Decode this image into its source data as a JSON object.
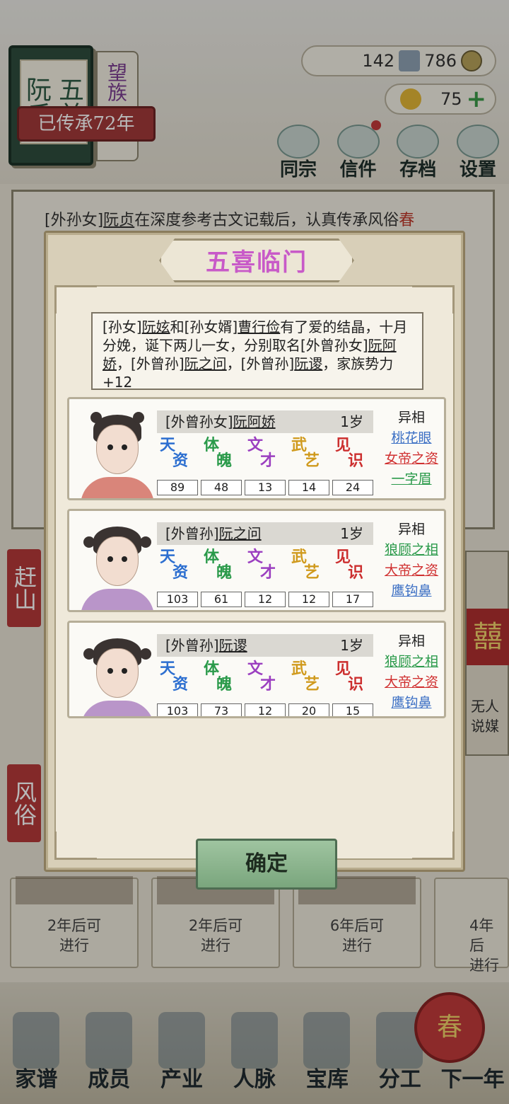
{
  "family": {
    "cover_title": "五羊阮氏",
    "side_title": "望族",
    "heritage": "已传承72年"
  },
  "resources": {
    "silver": "142",
    "coins": "786",
    "gold": "75"
  },
  "top_menu": [
    {
      "label": "同宗",
      "icon": "family-icon"
    },
    {
      "label": "信件",
      "icon": "letter-icon"
    },
    {
      "label": "存档",
      "icon": "save-icon"
    },
    {
      "label": "设置",
      "icon": "settings-icon"
    }
  ],
  "notice": {
    "prefix": "[外孙女]",
    "name": "阮贞",
    "body": "在深度参考古文记载后，认真传承风俗",
    "highlight": "春"
  },
  "side_tags": {
    "left_top": "赶山",
    "left_bottom": "风俗"
  },
  "right_card": {
    "text": "无人说媒"
  },
  "tasks": [
    {
      "text1": "2年后可",
      "text2": "进行"
    },
    {
      "text1": "2年后可",
      "text2": "进行"
    },
    {
      "text1": "6年后可",
      "text2": "进行"
    },
    {
      "text1": "4年后",
      "text2": "进行"
    }
  ],
  "nav": [
    {
      "label": "家谱"
    },
    {
      "label": "成员"
    },
    {
      "label": "产业"
    },
    {
      "label": "人脉"
    },
    {
      "label": "宝库"
    },
    {
      "label": "分工"
    },
    {
      "label": "下一年"
    }
  ],
  "lantern": "春",
  "dialog": {
    "title": "五喜临门",
    "message_parts": {
      "p1": "[孙女]",
      "n1": "阮妶",
      "p2": "和[孙女婿]",
      "n2": "曹行俭",
      "p3": "有了爱的结晶，十月分娩，诞下两儿一女，分别取名[外曾孙女]",
      "n3": "阮阿娇",
      "p4": "，[外曾孙]",
      "n4": "阮之问",
      "p5": "，[外曾孙]",
      "n5": "阮谡",
      "p6": "，家族势力+12"
    },
    "stat_labels": [
      {
        "a": "天",
        "b": "资",
        "color": "#2d6fd0"
      },
      {
        "a": "体",
        "b": "魄",
        "color": "#2a9a4a"
      },
      {
        "a": "文",
        "b": "才",
        "color": "#9b3fc0"
      },
      {
        "a": "武",
        "b": "艺",
        "color": "#d09a1d"
      },
      {
        "a": "见",
        "b": "识",
        "color": "#cc2f2f"
      }
    ],
    "children": [
      {
        "prefix": "[外曾孙女]",
        "name": "阮阿娇",
        "age": "1岁",
        "stats": [
          "89",
          "48",
          "13",
          "14",
          "24"
        ],
        "traits_header": "异相",
        "traits": [
          {
            "text": "桃花眼",
            "color": "#3b6fc4"
          },
          {
            "text": "女帝之资",
            "color": "#d03030"
          },
          {
            "text": "一字眉",
            "color": "#2a9a4a"
          }
        ]
      },
      {
        "prefix": "[外曾孙]",
        "name": "阮之问",
        "age": "1岁",
        "stats": [
          "103",
          "61",
          "12",
          "12",
          "17"
        ],
        "traits_header": "异相",
        "traits": [
          {
            "text": "狼顾之相",
            "color": "#2a9a4a"
          },
          {
            "text": "大帝之资",
            "color": "#d03030"
          },
          {
            "text": "鹰钩鼻",
            "color": "#3b6fc4"
          }
        ]
      },
      {
        "prefix": "[外曾孙]",
        "name": "阮谡",
        "age": "1岁",
        "stats": [
          "103",
          "73",
          "12",
          "20",
          "15"
        ],
        "traits_header": "异相",
        "traits": [
          {
            "text": "狼顾之相",
            "color": "#2a9a4a"
          },
          {
            "text": "大帝之资",
            "color": "#d03030"
          },
          {
            "text": "鹰钩鼻",
            "color": "#3b6fc4"
          }
        ]
      }
    ],
    "confirm_label": "确定"
  }
}
